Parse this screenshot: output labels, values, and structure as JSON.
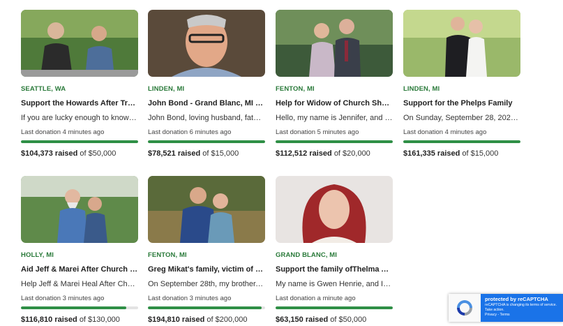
{
  "cards": [
    {
      "location": "SEATTLE, WA",
      "title": "Support the Howards After Tragic ...",
      "snippet": "If you are lucky enough to know t...",
      "last_donation": "Last donation 4 minutes ago",
      "raised": "$104,373 raised",
      "goal": "of $50,000",
      "progress": 1.0,
      "photo": "couple-photo"
    },
    {
      "location": "LINDEN, MI",
      "title": "John Bond - Grand Blanc, MI Shoo...",
      "snippet": "John Bond, loving husband, fathe...",
      "last_donation": "Last donation 6 minutes ago",
      "raised": "$78,521 raised",
      "goal": "of $15,000",
      "progress": 1.0,
      "photo": "portrait-photo"
    },
    {
      "location": "FENTON, MI",
      "title": "Help for Widow of Church Shootin...",
      "snippet": "Hello, my name is Jennifer, and my...",
      "last_donation": "Last donation 5 minutes ago",
      "raised": "$112,512 raised",
      "goal": "of $20,000",
      "progress": 1.0,
      "photo": "couple-photo"
    },
    {
      "location": "LINDEN, MI",
      "title": "Support for the Phelps Family",
      "snippet": "On Sunday, September 28, 2025, a...",
      "last_donation": "Last donation 4 minutes ago",
      "raised": "$161,335 raised",
      "goal": "of $15,000",
      "progress": 1.0,
      "photo": "wedding-photo"
    },
    {
      "location": "HOLLY, MI",
      "title": "Aid Jeff & Marei After Church Sho...",
      "snippet": "Help Jeff & Marei Heal After Churc...",
      "last_donation": "Last donation 3 minutes ago",
      "raised": "$116,810 raised",
      "goal": "of $130,000",
      "progress": 0.9,
      "photo": "couple-photo"
    },
    {
      "location": "FENTON, MI",
      "title": "Greg Mikat's family, victim of the ...",
      "snippet": "On September 28th, my brother, ...",
      "last_donation": "Last donation 3 minutes ago",
      "raised": "$194,810 raised",
      "goal": "of $200,000",
      "progress": 0.97,
      "photo": "couple-photo"
    },
    {
      "location": "GRAND BLANC, MI",
      "title": "Support the family ofThelma Arm...",
      "snippet": "My name is Gwen Henrie, and I am...",
      "last_donation": "Last donation a minute ago",
      "raised": "$63,150 raised",
      "goal": "of $50,000",
      "progress": 1.0,
      "photo": "portrait-photo"
    }
  ],
  "recaptcha": {
    "title": "protected by reCAPTCHA",
    "body": "reCAPTCHA is changing its terms of service. Take action.",
    "links": "Privacy - Terms"
  },
  "colors": {
    "accent": "#2f8f46",
    "location": "#2a7a3a",
    "recaptcha_blue": "#1a73e8"
  }
}
